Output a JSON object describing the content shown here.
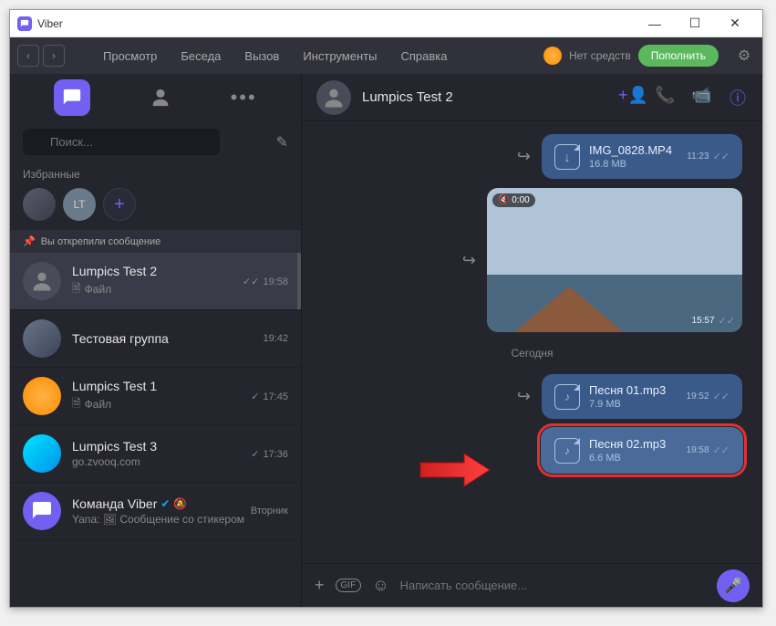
{
  "window": {
    "title": "Viber"
  },
  "menu": {
    "items": [
      "Просмотр",
      "Беседа",
      "Вызов",
      "Инструменты",
      "Справка"
    ],
    "balance": "Нет средств",
    "topup": "Пополнить"
  },
  "sidebar": {
    "search_placeholder": "Поиск...",
    "favorites_label": "Избранные",
    "fav_initials": "LT",
    "pinned": "Вы открепили сообщение",
    "chats": [
      {
        "name": "Lumpics Test 2",
        "preview": "Файл",
        "time": "19:58",
        "read": "✓✓",
        "avatar": "grey",
        "selected": true,
        "file_icon": true
      },
      {
        "name": "Тестовая группа",
        "preview": "",
        "time": "19:42",
        "avatar": "photo"
      },
      {
        "name": "Lumpics Test 1",
        "preview": "Файл",
        "time": "17:45",
        "read": "✓",
        "avatar": "orange",
        "file_icon": true
      },
      {
        "name": "Lumpics Test 3",
        "preview": "go.zvooq.com",
        "time": "17:36",
        "read": "✓",
        "avatar": "cyan"
      },
      {
        "name": "Команда Viber",
        "preview": "Yana: 🖼 Сообщение со стикером",
        "time": "Вторник",
        "avatar": "viber",
        "verified": true,
        "muted": true
      }
    ]
  },
  "chat": {
    "title": "Lumpics Test 2",
    "messages": {
      "file1": {
        "name": "IMG_0828.MP4",
        "size": "16.8 MB",
        "time": "11:23"
      },
      "video": {
        "mute": "🔇 0:00",
        "time": "15:57"
      },
      "date": "Сегодня",
      "file2": {
        "name": "Песня 01.mp3",
        "size": "7.9 MB",
        "time": "19:52"
      },
      "file3": {
        "name": "Песня 02.mp3",
        "size": "6.6 MB",
        "time": "19:58"
      }
    },
    "composer_placeholder": "Написать сообщение...",
    "gif": "GIF"
  }
}
